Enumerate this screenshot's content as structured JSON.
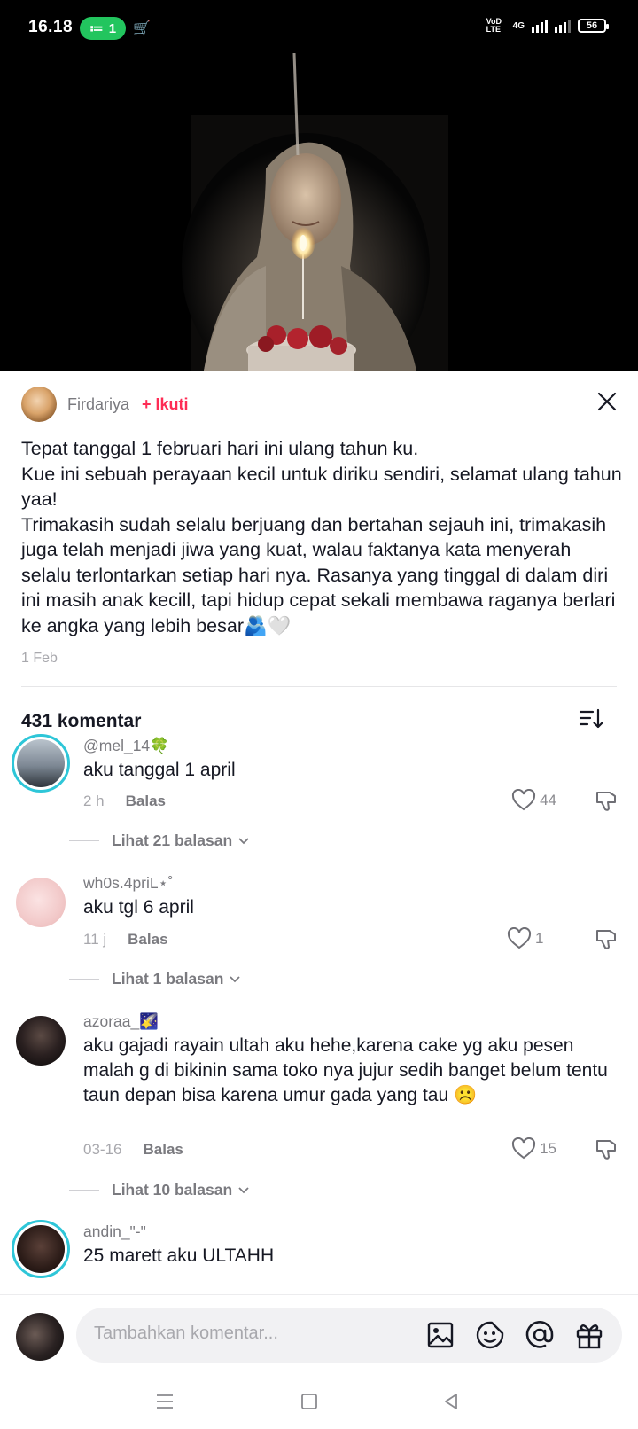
{
  "status_bar": {
    "time": "16.18",
    "hotspot_count": "1",
    "network": "4G",
    "volte": "VoD LTE",
    "battery": "56"
  },
  "post": {
    "author": "Firdariya",
    "follow_label": "+ Ikuti",
    "caption": "Tepat tanggal 1 februari hari ini ulang tahun ku.\nKue ini sebuah perayaan kecil untuk diriku sendiri, selamat ulang tahun yaa!\nTrimakasih sudah selalu berjuang dan bertahan sejauh ini, trimakasih juga telah menjadi jiwa yang kuat, walau faktanya kata menyerah selalu terlontarkan setiap hari nya. Rasanya yang tinggal di dalam diri ini masih anak kecill, tapi hidup cepat sekali membawa raganya berlari ke angka yang lebih besar🫂🤍",
    "date": "1 Feb"
  },
  "comments_header": {
    "count_label": "431 komentar"
  },
  "comments": [
    {
      "username": "@mel_14🍀",
      "text": "aku tanggal 1 april",
      "time": "2 h",
      "reply_label": "Balas",
      "likes": "44",
      "more_replies": "Lihat 21 balasan"
    },
    {
      "username": "wh0s.4priL⋆˚",
      "text": "aku tgl 6 april",
      "time": "11 j",
      "reply_label": "Balas",
      "likes": "1",
      "more_replies": "Lihat 1 balasan"
    },
    {
      "username": "azoraa_🌠",
      "text": "aku gajadi rayain ultah aku hehe,karena cake yg aku pesen malah g di bikinin sama toko nya jujur sedih banget belum tentu taun depan bisa karena umur gada yang tau ☹️",
      "time": "03-16",
      "reply_label": "Balas",
      "likes": "15",
      "more_replies": "Lihat 10 balasan"
    },
    {
      "username": "andin_\"-\"",
      "text": "25 marett aku ULTAHH"
    }
  ],
  "input_bar": {
    "placeholder": "Tambahkan komentar..."
  },
  "colors": {
    "accent": "#fe2c55",
    "story_ring": "#2ec6d8",
    "hotspot": "#22c55e"
  },
  "icons": [
    "close-icon",
    "sort-icon",
    "heart-icon",
    "dislike-icon",
    "chevron-down-icon",
    "image-icon",
    "emoji-icon",
    "mention-icon",
    "gift-icon",
    "menu-nav-icon",
    "home-nav-icon",
    "back-nav-icon"
  ]
}
